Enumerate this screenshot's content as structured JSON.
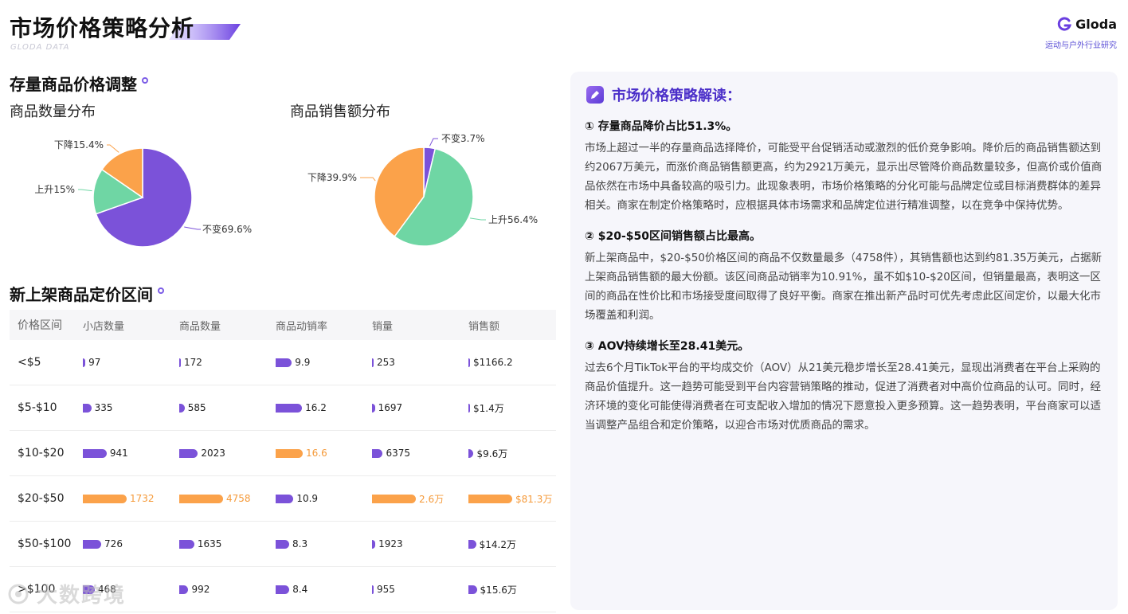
{
  "header": {
    "title": "市场价格策略分析",
    "subtitle": "GLODA DATA",
    "brand_name": "Gloda",
    "brand_tagline": "运动与户外行业研究"
  },
  "section1_title": "存量商品价格调整",
  "section2_title": "新上架商品定价区间",
  "colors": {
    "purple": "#7b52d9",
    "green": "#6fd6a4",
    "orange": "#fba24a",
    "accent": "#4b2fc9"
  },
  "chart_data": [
    {
      "type": "pie",
      "title": "商品数量分布",
      "slices": [
        {
          "label": "不变69.6%",
          "value": 69.6,
          "color": "#7b52d9"
        },
        {
          "label": "上升15%",
          "value": 15.0,
          "color": "#6fd6a4"
        },
        {
          "label": "下降15.4%",
          "value": 15.4,
          "color": "#fba24a"
        }
      ]
    },
    {
      "type": "pie",
      "title": "商品销售额分布",
      "slices": [
        {
          "label": "不变3.7%",
          "value": 3.7,
          "color": "#7b52d9"
        },
        {
          "label": "上升56.4%",
          "value": 56.4,
          "color": "#6fd6a4"
        },
        {
          "label": "下降39.9%",
          "value": 39.9,
          "color": "#fba24a"
        }
      ]
    },
    {
      "type": "table",
      "columns": [
        "价格区间",
        "小店数量",
        "商品数量",
        "商品动销率",
        "销量",
        "销售额"
      ],
      "rows": [
        {
          "range": "<$5",
          "shops": 97,
          "shops_label": "97",
          "items": 172,
          "items_label": "172",
          "rate": 9.9,
          "rate_label": "9.9",
          "sales": 253,
          "sales_label": "253",
          "revenue": 1166.2,
          "revenue_label": "$1166.2"
        },
        {
          "range": "$5-$10",
          "shops": 335,
          "shops_label": "335",
          "items": 585,
          "items_label": "585",
          "rate": 16.2,
          "rate_label": "16.2",
          "sales": 1697,
          "sales_label": "1697",
          "revenue": 14000,
          "revenue_label": "$1.4万"
        },
        {
          "range": "$10-$20",
          "shops": 941,
          "shops_label": "941",
          "items": 2023,
          "items_label": "2023",
          "rate": 16.6,
          "rate_label": "16.6",
          "sales": 6375,
          "sales_label": "6375",
          "revenue": 96000,
          "revenue_label": "$9.6万"
        },
        {
          "range": "$20-$50",
          "shops": 1732,
          "shops_label": "1732",
          "items": 4758,
          "items_label": "4758",
          "rate": 10.9,
          "rate_label": "10.9",
          "sales": 26000,
          "sales_label": "2.6万",
          "revenue": 813000,
          "revenue_label": "$81.3万"
        },
        {
          "range": "$50-$100",
          "shops": 726,
          "shops_label": "726",
          "items": 1635,
          "items_label": "1635",
          "rate": 8.3,
          "rate_label": "8.3",
          "sales": 1923,
          "sales_label": "1923",
          "revenue": 142000,
          "revenue_label": "$14.2万"
        },
        {
          "range": ">$100",
          "shops": 468,
          "shops_label": "468",
          "items": 992,
          "items_label": "992",
          "rate": 8.4,
          "rate_label": "8.4",
          "sales": 955,
          "sales_label": "955",
          "revenue": 156000,
          "revenue_label": "$15.6万"
        }
      ]
    }
  ],
  "panel": {
    "title": "市场价格策略解读：",
    "points": [
      {
        "title": "① 存量商品降价占比51.3%。",
        "body": "市场上超过一半的存量商品选择降价，可能受平台促销活动或激烈的低价竞争影响。降价后的商品销售额达到约2067万美元，而涨价商品销售额更高，约为2921万美元，显示出尽管降价商品数量较多，但高价或价值商品依然在市场中具备较高的吸引力。此现象表明，市场价格策略的分化可能与品牌定位或目标消费群体的差异相关。商家在制定价格策略时，应根据具体市场需求和品牌定位进行精准调整，以在竞争中保持优势。"
      },
      {
        "title": "② $20-$50区间销售额占比最高。",
        "body": "新上架商品中，$20-$50价格区间的商品不仅数量最多（4758件），其销售额也达到约81.35万美元，占据新上架商品销售额的最大份额。该区间商品动销率为10.91%，虽不如$10-$20区间，但销量最高，表明这一区间的商品在性价比和市场接受度间取得了良好平衡。商家在推出新产品时可优先考虑此区间定价，以最大化市场覆盖和利润。"
      },
      {
        "title": "③ AOV持续增长至28.41美元。",
        "body": "过去6个月TikTok平台的平均成交价（AOV）从21美元稳步增长至28.41美元，显现出消费者在平台上采购的商品价值提升。这一趋势可能受到平台内容营销策略的推动，促进了消费者对中高价位商品的认可。同时，经济环境的变化可能使得消费者在可支配收入增加的情况下愿意投入更多预算。这一趋势表明，平台商家可以适当调整产品组合和定价策略，以迎合市场对优质商品的需求。"
      }
    ]
  },
  "watermark": "大数跨境"
}
